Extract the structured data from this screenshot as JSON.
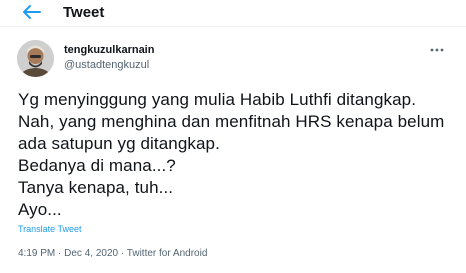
{
  "header": {
    "title": "Tweet"
  },
  "author": {
    "name": "tengkuzulkarnain",
    "handle": "@ustadtengkuzul"
  },
  "tweet": {
    "lines": [
      "Yg menyinggung yang mulia Habib Luthfi ditangkap.",
      "Nah, yang menghina dan menfitnah HRS kenapa belum",
      "ada satupun yg ditangkap.",
      "Bedanya di mana...?",
      "Tanya kenapa, tuh...",
      "Ayo..."
    ],
    "translate_label": "Translate Tweet"
  },
  "meta": {
    "time": "4:19 PM",
    "separator": " · ",
    "date": "Dec 4, 2020",
    "source": "Twitter for Android"
  },
  "colors": {
    "accent": "#1d9bf0",
    "text": "#0f1419",
    "secondary": "#536471"
  },
  "icons": {
    "back": "back-arrow-icon",
    "more": "more-options-icon"
  }
}
